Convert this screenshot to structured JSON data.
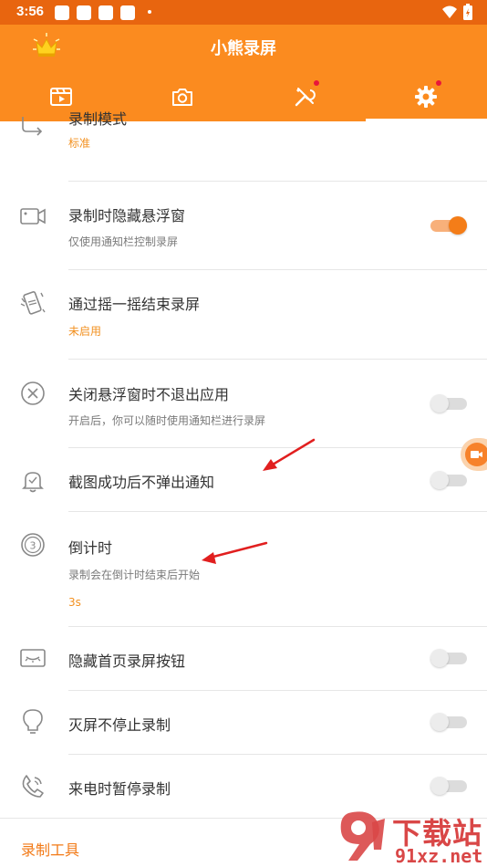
{
  "status_bar": {
    "time": "3:56"
  },
  "app_bar": {
    "title": "小熊录屏",
    "tabs": [
      {
        "name": "videos",
        "icon": "film-icon"
      },
      {
        "name": "screenshots",
        "icon": "camera-icon"
      },
      {
        "name": "tools",
        "icon": "tools-icon"
      },
      {
        "name": "settings",
        "icon": "gear-icon"
      }
    ],
    "active_tab": "settings"
  },
  "settings": {
    "record_mode": {
      "title": "录制模式",
      "value": "标准"
    },
    "hide_float": {
      "title": "录制时隐藏悬浮窗",
      "subtitle": "仅使用通知栏控制录屏",
      "enabled": true
    },
    "shake_stop": {
      "title": "通过摇一摇结束录屏",
      "value": "未启用"
    },
    "close_float": {
      "title": "关闭悬浮窗时不退出应用",
      "subtitle": "开启后，你可以随时使用通知栏进行录屏",
      "enabled": false
    },
    "no_notify": {
      "title": "截图成功后不弹出通知",
      "enabled": false
    },
    "countdown": {
      "title": "倒计时",
      "subtitle": "录制会在倒计时结束后开始",
      "value": "3s"
    },
    "hide_home_btn": {
      "title": "隐藏首页录屏按钮",
      "enabled": false
    },
    "screen_off": {
      "title": "灭屏不停止录制",
      "enabled": false
    },
    "call_pause": {
      "title": "来电时暂停录制",
      "enabled": false
    }
  },
  "section": {
    "title": "录制工具"
  },
  "watermark": {
    "line1": "下载站",
    "line2": "91xz.net"
  },
  "colors": {
    "status_bar": "#e8650f",
    "app_bar": "#fb8b1f",
    "accent": "#f47d18",
    "arrow": "#e11f1f"
  }
}
